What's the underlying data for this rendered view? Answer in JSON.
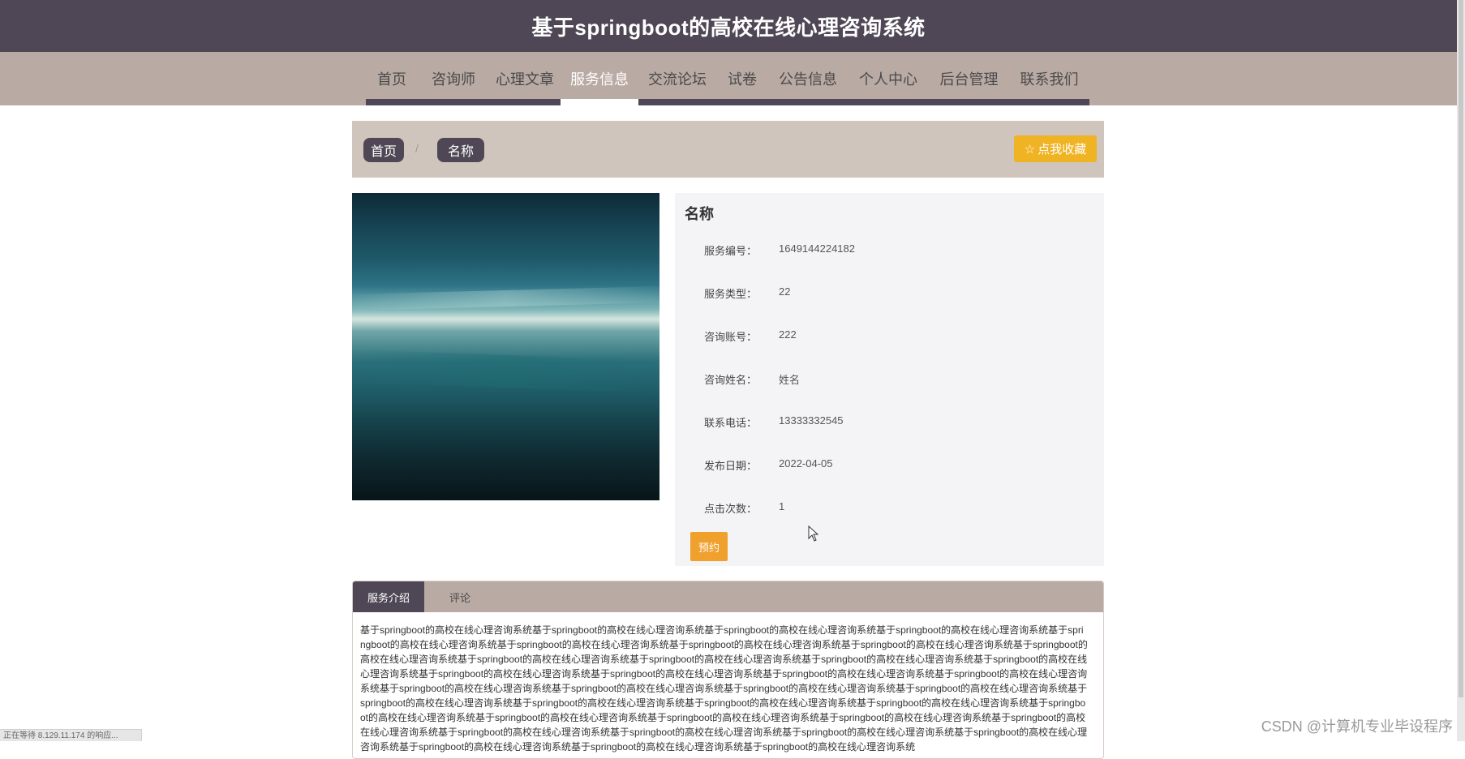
{
  "header": {
    "title": "基于springboot的高校在线心理咨询系统"
  },
  "nav": {
    "items": [
      {
        "label": "首页"
      },
      {
        "label": "咨询师"
      },
      {
        "label": "心理文章"
      },
      {
        "label": "服务信息",
        "active": true
      },
      {
        "label": "交流论坛"
      },
      {
        "label": "试卷"
      },
      {
        "label": "公告信息"
      },
      {
        "label": "个人中心"
      },
      {
        "label": "后台管理"
      },
      {
        "label": "联系我们"
      }
    ]
  },
  "breadcrumb": {
    "home": "首页",
    "separator": "/",
    "current": "名称"
  },
  "favorite_button": {
    "label": "点我收藏",
    "icon": "star-icon"
  },
  "detail": {
    "title": "名称",
    "fields": [
      {
        "label": "服务编号：",
        "value": "1649144224182"
      },
      {
        "label": "服务类型：",
        "value": "22"
      },
      {
        "label": "咨询账号：",
        "value": "222"
      },
      {
        "label": "咨询姓名：",
        "value": "姓名"
      },
      {
        "label": "联系电话：",
        "value": "13333332545"
      },
      {
        "label": "发布日期：",
        "value": "2022-04-05"
      },
      {
        "label": "点击次数：",
        "value": "1"
      }
    ],
    "book_button": "预约"
  },
  "tabs": {
    "items": [
      {
        "label": "服务介绍",
        "active": true
      },
      {
        "label": "评论"
      }
    ],
    "intro_text": "基于springboot的高校在线心理咨询系统基于springboot的高校在线心理咨询系统基于springboot的高校在线心理咨询系统基于springboot的高校在线心理咨询系统基于springboot的高校在线心理咨询系统基于springboot的高校在线心理咨询系统基于springboot的高校在线心理咨询系统基于springboot的高校在线心理咨询系统基于springboot的高校在线心理咨询系统基于springboot的高校在线心理咨询系统基于springboot的高校在线心理咨询系统基于springboot的高校在线心理咨询系统基于springboot的高校在线心理咨询系统基于springboot的高校在线心理咨询系统基于springboot的高校在线心理咨询系统基于springboot的高校在线心理咨询系统基于springboot的高校在线心理咨询系统基于springboot的高校在线心理咨询系统基于springboot的高校在线心理咨询系统基于springboot的高校在线心理咨询系统基于springboot的高校在线心理咨询系统基于springboot的高校在线心理咨询系统基于springboot的高校在线心理咨询系统基于springboot的高校在线心理咨询系统基于springboot的高校在线心理咨询系统基于springboot的高校在线心理咨询系统基于springboot的高校在线心理咨询系统基于springboot的高校在线心理咨询系统基于springboot的高校在线心理咨询系统基于springboot的高校在线心理咨询系统基于springboot的高校在线心理咨询系统基于springboot的高校在线心理咨询系统基于springboot的高校在线心理咨询系统基于springboot的高校在线心理咨询系统基于springboot的高校在线心理咨询系统基于springboot的高校在线心理咨询系统基于springboot的高校在线心理咨询系统"
  },
  "status_bar": {
    "text": "正在等待 8.129.11.174 的响应..."
  },
  "watermark": {
    "text": "CSDN @计算机专业毕设程序"
  }
}
